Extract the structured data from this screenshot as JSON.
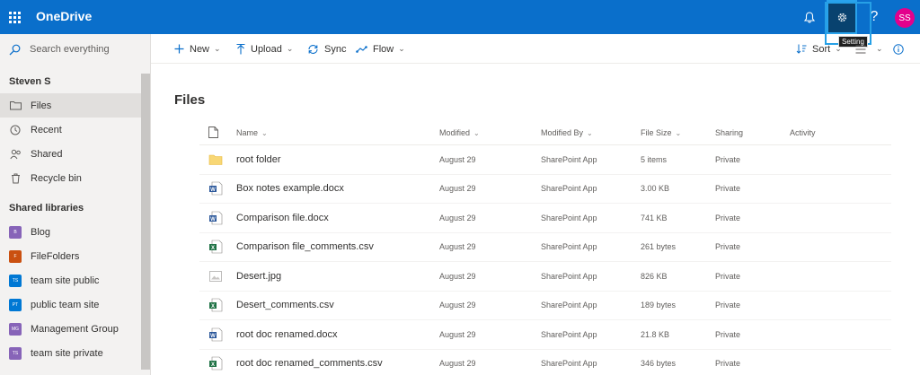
{
  "app": {
    "title": "OneDrive"
  },
  "topbar": {
    "notifications_icon": "bell-icon",
    "settings_icon": "gear-icon",
    "help_label": "?",
    "avatar_initials": "SS",
    "settings_tooltip": "Setting"
  },
  "search": {
    "placeholder": "Search everything"
  },
  "nav": {
    "user": "Steven S",
    "items": [
      {
        "label": "Files",
        "icon": "folder-icon",
        "selected": true
      },
      {
        "label": "Recent",
        "icon": "clock-icon",
        "selected": false
      },
      {
        "label": "Shared",
        "icon": "people-icon",
        "selected": false
      },
      {
        "label": "Recycle bin",
        "icon": "trash-icon",
        "selected": false
      }
    ],
    "libraries_title": "Shared libraries",
    "libraries": [
      {
        "label": "Blog",
        "abbr": "B",
        "color": "#8764b8"
      },
      {
        "label": "FileFolders",
        "abbr": "F",
        "color": "#ca5010"
      },
      {
        "label": "team site public",
        "abbr": "TS",
        "color": "#0078d4"
      },
      {
        "label": "public team site",
        "abbr": "PT",
        "color": "#0078d4"
      },
      {
        "label": "Management Group",
        "abbr": "MG",
        "color": "#8764b8"
      },
      {
        "label": "team site private",
        "abbr": "TS",
        "color": "#8764b8"
      }
    ]
  },
  "commands": {
    "new": "New",
    "upload": "Upload",
    "sync": "Sync",
    "flow": "Flow",
    "sort": "Sort"
  },
  "main": {
    "title": "Files",
    "columns": {
      "name": "Name",
      "modified": "Modified",
      "modified_by": "Modified By",
      "file_size": "File Size",
      "sharing": "Sharing",
      "activity": "Activity"
    },
    "rows": [
      {
        "name": "root folder",
        "type": "folder",
        "modified": "August 29",
        "modified_by": "SharePoint App",
        "size": "5 items",
        "sharing": "Private"
      },
      {
        "name": "Box notes example.docx",
        "type": "word",
        "modified": "August 29",
        "modified_by": "SharePoint App",
        "size": "3.00 KB",
        "sharing": "Private"
      },
      {
        "name": "Comparison file.docx",
        "type": "word",
        "modified": "August 29",
        "modified_by": "SharePoint App",
        "size": "741 KB",
        "sharing": "Private"
      },
      {
        "name": "Comparison file_comments.csv",
        "type": "excel",
        "modified": "August 29",
        "modified_by": "SharePoint App",
        "size": "261 bytes",
        "sharing": "Private"
      },
      {
        "name": "Desert.jpg",
        "type": "image",
        "modified": "August 29",
        "modified_by": "SharePoint App",
        "size": "826 KB",
        "sharing": "Private"
      },
      {
        "name": "Desert_comments.csv",
        "type": "excel",
        "modified": "August 29",
        "modified_by": "SharePoint App",
        "size": "189 bytes",
        "sharing": "Private"
      },
      {
        "name": "root doc renamed.docx",
        "type": "word",
        "modified": "August 29",
        "modified_by": "SharePoint App",
        "size": "21.8 KB",
        "sharing": "Private"
      },
      {
        "name": "root doc renamed_comments.csv",
        "type": "excel",
        "modified": "August 29",
        "modified_by": "SharePoint App",
        "size": "346 bytes",
        "sharing": "Private"
      }
    ]
  },
  "colors": {
    "topbar": "#0a6fcb",
    "avatar": "#e3008c",
    "highlight": "#26a0e6"
  }
}
